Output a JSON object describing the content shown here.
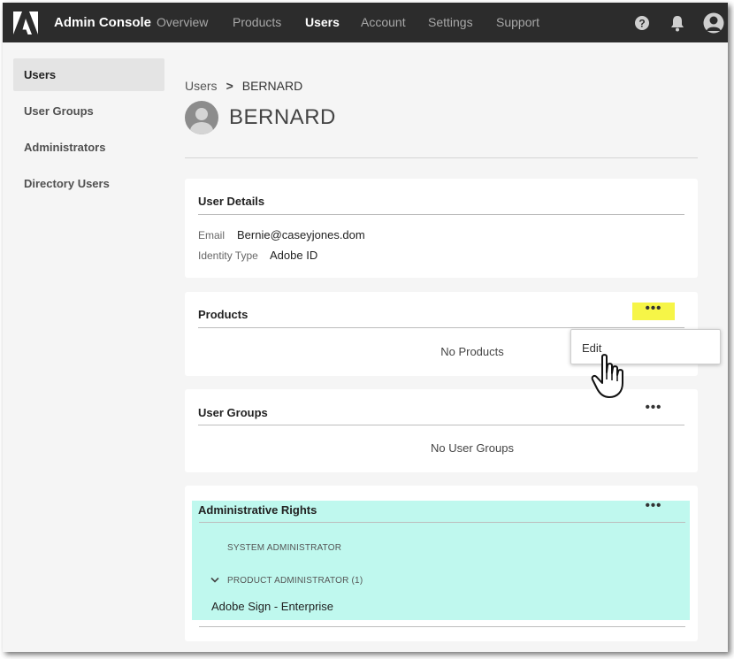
{
  "app": {
    "title": "Admin Console"
  },
  "nav": {
    "items": [
      {
        "label": "Overview",
        "active": false
      },
      {
        "label": "Products",
        "active": false
      },
      {
        "label": "Users",
        "active": true
      },
      {
        "label": "Account",
        "active": false
      },
      {
        "label": "Settings",
        "active": false
      },
      {
        "label": "Support",
        "active": false
      }
    ],
    "icons": [
      "help-icon",
      "bell-icon",
      "avatar-icon"
    ]
  },
  "sidebar": {
    "items": [
      {
        "label": "Users",
        "active": true
      },
      {
        "label": "User Groups",
        "active": false
      },
      {
        "label": "Administrators",
        "active": false
      },
      {
        "label": "Directory Users",
        "active": false
      }
    ]
  },
  "breadcrumb": {
    "parent": "Users",
    "current": "BERNARD"
  },
  "user": {
    "name": "BERNARD"
  },
  "details": {
    "title": "User Details",
    "email_label": "Email",
    "email": "Bernie@caseyjones.dom",
    "identity_label": "Identity Type",
    "identity": "Adobe ID"
  },
  "products": {
    "title": "Products",
    "empty": "No Products",
    "menu_label": "•••"
  },
  "popup": {
    "edit": "Edit"
  },
  "groups": {
    "title": "User Groups",
    "empty": "No User Groups",
    "menu_label": "•••"
  },
  "admin": {
    "title": "Administrative Rights",
    "menu_label": "•••",
    "system_role": "SYSTEM ADMINISTRATOR",
    "product_role": "PRODUCT ADMINISTRATOR (1)",
    "product": "Adobe Sign - Enterprise"
  },
  "colors": {
    "nav_bg": "#2c2c2c",
    "highlight_yellow": "#f6f547",
    "highlight_cyan": "#bff8ee"
  }
}
